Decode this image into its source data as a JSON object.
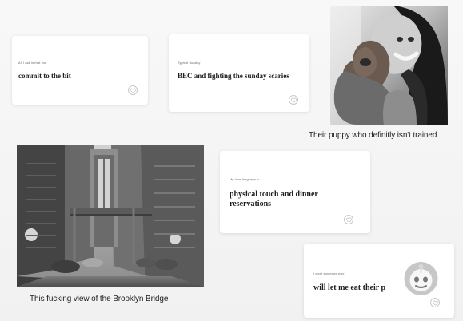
{
  "prompt_cards": [
    {
      "prompt": "All I ask is that you",
      "answer": "commit to the bit"
    },
    {
      "prompt": "Typical Sunday",
      "answer": "BEC and fighting the sunday scaries"
    },
    {
      "prompt": "My love language is",
      "answer": "physical touch and dinner reservations"
    },
    {
      "prompt": "I want someone who",
      "answer": "will let me eat their p"
    }
  ],
  "photo_cards": [
    {
      "caption": "Their puppy who definitly isn't trained"
    },
    {
      "caption": "This fucking view of the Brooklyn Bridge"
    }
  ],
  "icons": {
    "heart": "heart-icon",
    "avatar": "reddit-avatar-icon"
  }
}
